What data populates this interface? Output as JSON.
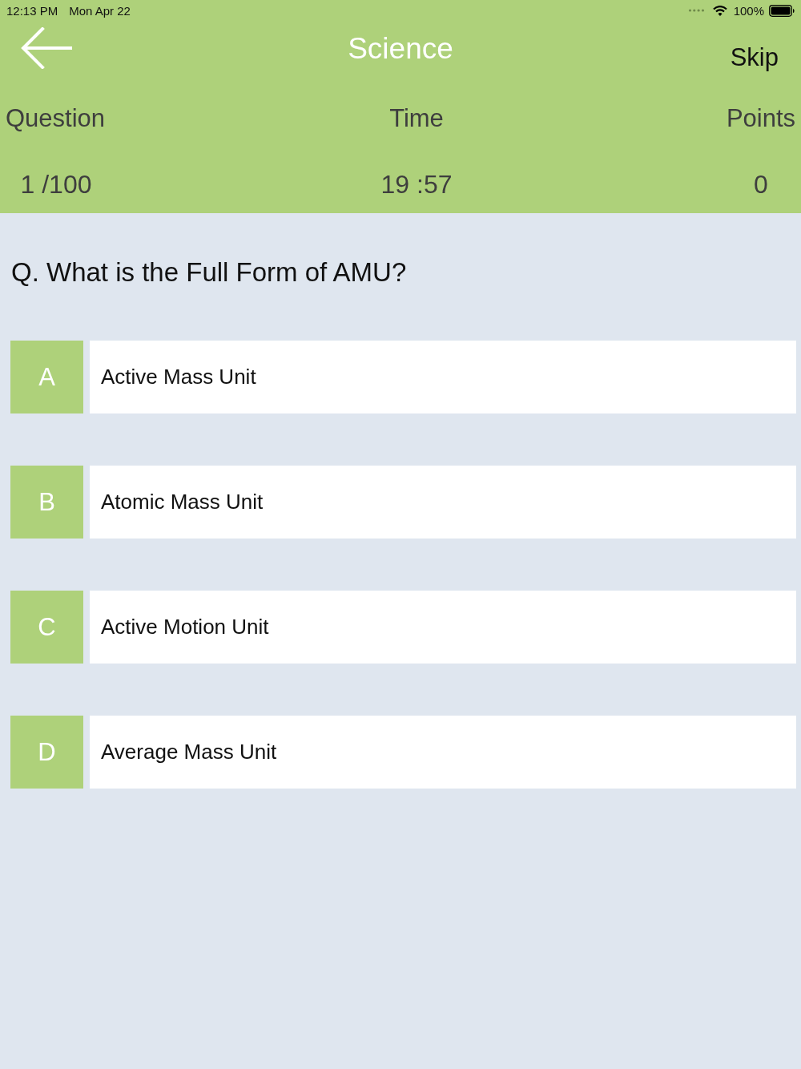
{
  "status_bar": {
    "time": "12:13 PM",
    "date": "Mon Apr 22",
    "battery": "100%"
  },
  "header": {
    "title": "Science",
    "skip": "Skip"
  },
  "stats": [
    {
      "label": "Question",
      "value": "1 /100"
    },
    {
      "label": "Time",
      "value": "19 :57"
    },
    {
      "label": "Points",
      "value": "0"
    }
  ],
  "question": "Q. What is the Full Form of AMU?",
  "options": [
    {
      "letter": "A",
      "text": "Active Mass Unit",
      "selected": false
    },
    {
      "letter": "B",
      "text": "Atomic Mass Unit",
      "selected": false
    },
    {
      "letter": "C",
      "text": "Active Motion Unit",
      "selected": false
    },
    {
      "letter": "D",
      "text": "Average Mass Unit",
      "selected": false
    }
  ]
}
